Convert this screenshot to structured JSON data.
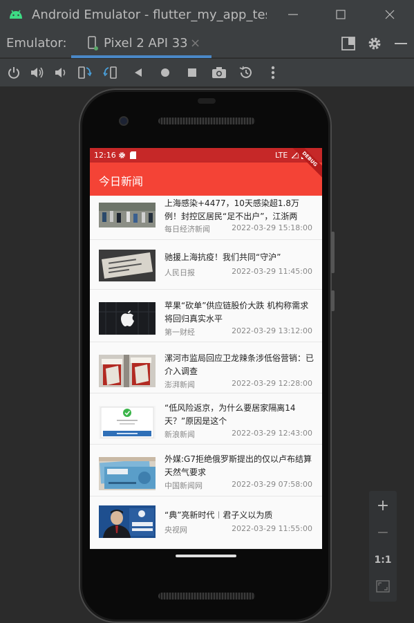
{
  "window": {
    "title": "Android Emulator - flutter_my_app_test",
    "icon": "android-icon"
  },
  "emulator_bar": {
    "label": "Emulator:",
    "device_tab": "Pixel 2 API 33",
    "close_symbol": "×"
  },
  "toolbar": {
    "buttons": [
      "power-icon",
      "volume-up-icon",
      "volume-down-icon",
      "rotate-left-icon",
      "rotate-right-icon",
      "back-icon",
      "home-icon",
      "overview-icon",
      "screenshot-icon",
      "snapshot-icon",
      "more-icon"
    ]
  },
  "device": {
    "status_time": "12:16",
    "network": "LTE",
    "debug_banner": "DEBUG",
    "app_title": "今日新闻",
    "news": [
      {
        "title": "上海感染+4477，10天感染超1.8万例！封控区居民“足不出户”，江浙两",
        "source": "每日经济新闻",
        "time": "2022-03-29 15:18:00"
      },
      {
        "title": "驰援上海抗疫！我们共同“守沪”",
        "source": "人民日报",
        "time": "2022-03-29 11:45:00"
      },
      {
        "title": "苹果“砍单”供应链股价大跌 机构称需求将回归真实水平",
        "source": "第一财经",
        "time": "2022-03-29 13:12:00"
      },
      {
        "title": "漯河市监局回应卫龙辣条涉低俗营销：已介入调查",
        "source": "澎湃新闻",
        "time": "2022-03-29 12:28:00"
      },
      {
        "title": "“低风险返京，为什么要居家隔离14天？”原因是这个",
        "source": "新浪新闻",
        "time": "2022-03-29 12:43:00"
      },
      {
        "title": "外媒:G7拒绝俄罗斯提出的仅以卢布结算天然气要求",
        "source": "中国新闻网",
        "time": "2022-03-29 07:58:00"
      },
      {
        "title": "“典”亮新时代︱君子义以为质",
        "source": "央视网",
        "time": "2022-03-29 11:55:00"
      }
    ]
  },
  "zoom_panel": {
    "zoom_in": "+",
    "zoom_out": "−",
    "one_to_one": "1:1"
  }
}
